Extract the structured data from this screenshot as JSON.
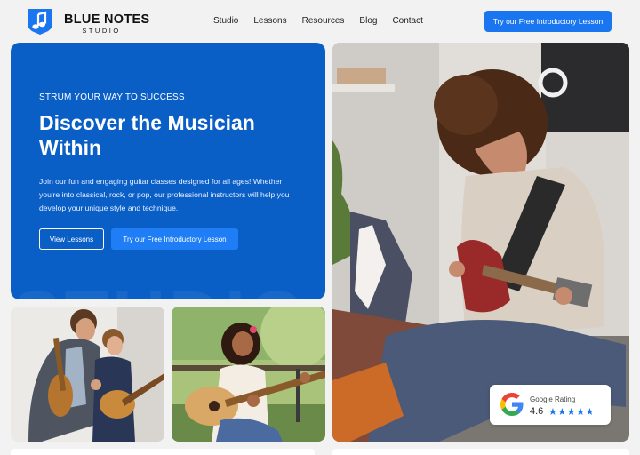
{
  "brand": {
    "name": "BLUE NOTES",
    "sub": "STUDIO",
    "accent": "#1976f0",
    "hero_bg": "#0a5fc7"
  },
  "nav": {
    "items": [
      "Studio",
      "Lessons",
      "Resources",
      "Blog",
      "Contact"
    ],
    "cta": "Try our Free Introductory Lesson"
  },
  "hero": {
    "eyebrow": "STRUM YOUR WAY TO SUCCESS",
    "title": "Discover the Musician Within",
    "description": "Join our fun and engaging guitar classes designed for all ages! Whether you're into classical, rock, or pop, our professional instructors will help you develop your unique style and technique.",
    "btn_secondary": "View Lessons",
    "btn_primary": "Try our Free Introductory Lesson",
    "watermark": "STUDIO"
  },
  "rating": {
    "label": "Google Rating",
    "score": "4.6",
    "stars": "★★★★★",
    "star_value": 4.6,
    "icon": "google-g-icon"
  }
}
